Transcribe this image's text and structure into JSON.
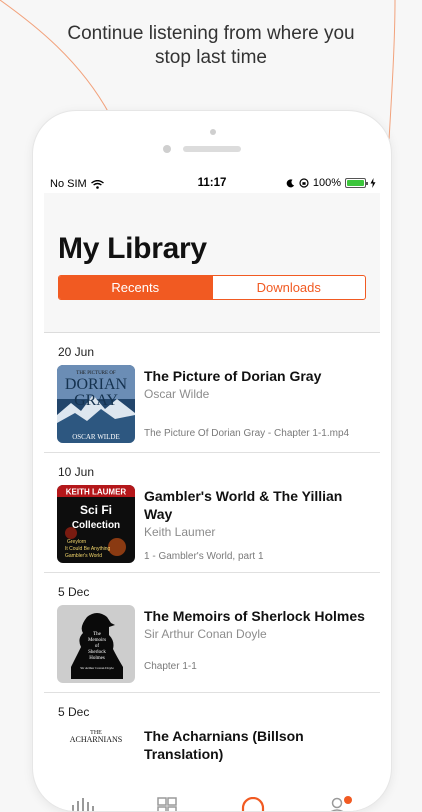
{
  "promo": {
    "line1": "Continue listening from where you",
    "line2": "stop last time"
  },
  "status_bar": {
    "carrier": "No SIM",
    "time": "11:17",
    "battery": "100%",
    "battery_level": 1.0
  },
  "library": {
    "title": "My Library",
    "tabs": [
      {
        "label": "Recents",
        "selected": true
      },
      {
        "label": "Downloads",
        "selected": false
      }
    ]
  },
  "books": [
    {
      "date": "20 Jun",
      "title": "The Picture of Dorian Gray",
      "author": "Oscar Wilde",
      "episode": "The Picture Of Dorian Gray - Chapter 1-1.mp4",
      "cover_text": [
        "THE PICTURE OF",
        "DORIAN",
        "GRAY",
        "OSCAR WILDE"
      ]
    },
    {
      "date": "10 Jun",
      "title": "Gambler's World & The Yillian Way",
      "author": "Keith Laumer",
      "episode": "1 - Gambler's World, part 1",
      "cover_text": [
        "KEITH LAUMER",
        "Sci Fi",
        "Collection",
        "Greylorn",
        "It Could Be Anything",
        "Gambler's World"
      ]
    },
    {
      "date": "5 Dec",
      "title": "The Memoirs of Sherlock Holmes",
      "author": "Sir Arthur Conan Doyle",
      "episode": "Chapter 1-1",
      "cover_text": [
        "The",
        "Memoirs",
        "of",
        "Sherlock",
        "Holmes",
        "Sir Arthur Conan Doyle"
      ]
    },
    {
      "date": "5 Dec",
      "title": "The Acharnians (Billson Translation)",
      "cover_text": [
        "THE",
        "ACHARNIANS"
      ]
    }
  ],
  "tab_bar": {
    "items": [
      "waveform-icon",
      "grid-icon",
      "headphones-icon",
      "profile-icon"
    ],
    "active_color": "#f15a22"
  },
  "colors": {
    "accent": "#f15a22",
    "background": "#f7f7f7"
  }
}
